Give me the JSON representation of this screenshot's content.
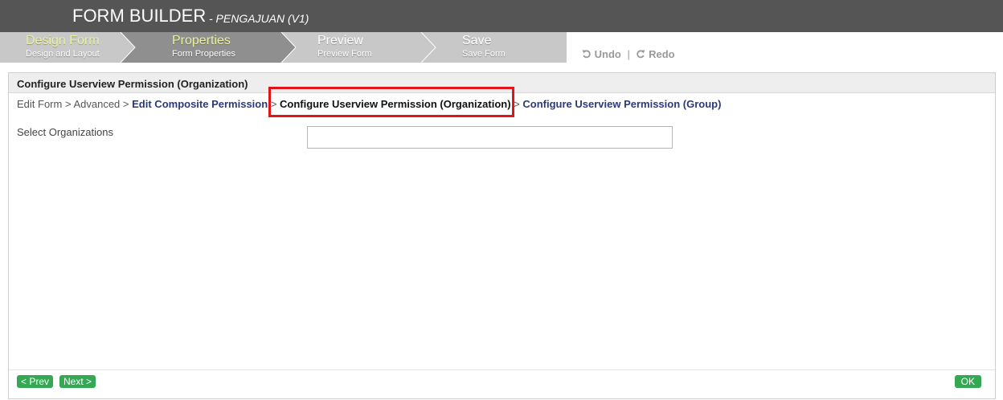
{
  "header": {
    "title": "FORM BUILDER",
    "subtitle": "- PENGAJUAN (V1)"
  },
  "steps": [
    {
      "label": "Design Form",
      "sub": "Design and Layout"
    },
    {
      "label": "Properties",
      "sub": "Form Properties"
    },
    {
      "label": "Preview",
      "sub": "Preview Form"
    },
    {
      "label": "Save",
      "sub": "Save Form"
    }
  ],
  "toolbar": {
    "undo_label": "Undo",
    "redo_label": "Redo",
    "separator": "|",
    "undo_icon": "undo-icon",
    "redo_icon": "redo-icon"
  },
  "panel": {
    "title": "Configure Userview Permission (Organization)"
  },
  "breadcrumb": {
    "items": [
      "Edit Form",
      "Advanced",
      "Edit Composite Permission",
      "Configure Userview Permission (Organization)",
      "Configure Userview Permission (Group)"
    ],
    "separator": ">"
  },
  "form": {
    "select_label": "Select Organizations",
    "select_value": ""
  },
  "buttons": {
    "prev": "< Prev",
    "next": "Next >",
    "ok": "OK"
  },
  "colors": {
    "header_bg": "#555555",
    "highlight": "#e0151c",
    "button_green": "#34a853",
    "link": "#2a3a7a"
  }
}
